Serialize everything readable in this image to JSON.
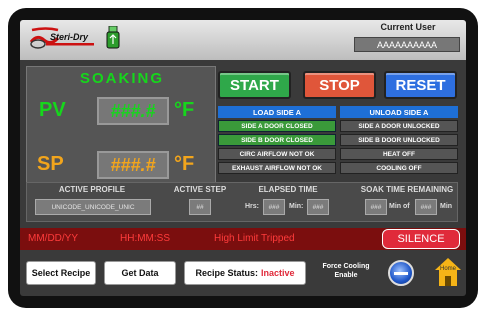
{
  "header": {
    "logo_text": "Steri-Dry",
    "usb_icon": "usb-drive-icon",
    "current_user_label": "Current User",
    "current_user_value": "AAAAAAAAAA"
  },
  "status_panel": {
    "state_title": "SOAKING",
    "pv_label": "PV",
    "pv_value": "###.#",
    "pv_unit": "°F",
    "sp_label": "SP",
    "sp_value": "###.#",
    "sp_unit": "°F"
  },
  "controls": {
    "start_label": "START",
    "stop_label": "STOP",
    "reset_label": "RESET"
  },
  "load_side": {
    "header": "LOAD SIDE A",
    "items": [
      "SIDE A DOOR CLOSED",
      "SIDE B DOOR CLOSED",
      "CIRC AIRFLOW NOT OK",
      "EXHAUST AIRFLOW NOT OK"
    ]
  },
  "unload_side": {
    "header": "UNLOAD SIDE A",
    "items": [
      "SIDE A DOOR UNLOCKED",
      "SIDE B DOOR UNLOCKED",
      "HEAT OFF",
      "COOLING OFF"
    ]
  },
  "info_bar": {
    "active_profile_label": "ACTIVE PROFILE",
    "active_profile_value": "UNICODE_UNICODE_UNIC",
    "active_step_label": "ACTIVE STEP",
    "active_step_value": "##",
    "elapsed_time_label": "ELAPSED TIME",
    "hrs_label": "Hrs:",
    "hrs_value": "###",
    "min_label": "Min:",
    "min_value": "###",
    "soak_remaining_label": "SOAK TIME REMAINING",
    "soak_value_1": "###",
    "soak_min_of": "Min of",
    "soak_value_2": "###",
    "soak_min": "Min"
  },
  "alarm_bar": {
    "date": "MM/DD/YY",
    "time": "HH:MM:SS",
    "message": "High Limit Tripped",
    "silence_label": "SILENCE"
  },
  "footer": {
    "select_recipe_label": "Select Recipe",
    "get_data_label": "Get Data",
    "recipe_status_label": "Recipe Status:",
    "recipe_status_value": "Inactive",
    "force_cooling_label": "Force Cooling\nEnable",
    "home_label": "Home"
  },
  "colors": {
    "start": "#2fa84a",
    "stop": "#e0563a",
    "reset": "#2e6fe0",
    "panel_text": "#16d61c",
    "sp_text": "#f2a51c",
    "alarm_bg": "#7b0e0e",
    "alarm_text": "#ff3b3b",
    "silence": "#e02a3a"
  }
}
